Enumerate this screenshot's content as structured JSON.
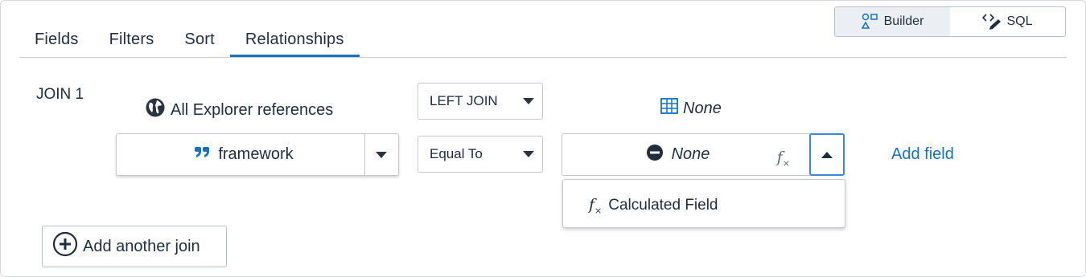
{
  "mode_toggle": {
    "builder_label": "Builder",
    "sql_label": "SQL",
    "active": "Builder"
  },
  "tabs": [
    {
      "label": "Fields"
    },
    {
      "label": "Filters"
    },
    {
      "label": "Sort"
    },
    {
      "label": "Relationships",
      "active": true
    }
  ],
  "join": {
    "label": "JOIN 1",
    "left_source": {
      "icon": "globe-icon",
      "label": "All Explorer references"
    },
    "join_type": {
      "value": "LEFT JOIN"
    },
    "right_source": {
      "icon": "table-grid-icon",
      "label": "None"
    },
    "left_field": {
      "icon": "quote-icon",
      "value": "framework"
    },
    "operator": {
      "value": "Equal To"
    },
    "right_field": {
      "icon": "minus-circle-icon",
      "value": "None",
      "fx_icon": "function-icon"
    },
    "add_field_label": "Add field",
    "dropdown_menu": {
      "items": [
        {
          "icon": "function-icon",
          "label": "Calculated Field"
        }
      ]
    }
  },
  "add_join_label": "Add another join",
  "colors": {
    "accent": "#1670c4",
    "focus_border": "#3b86d6",
    "text": "#1f2d3d"
  }
}
